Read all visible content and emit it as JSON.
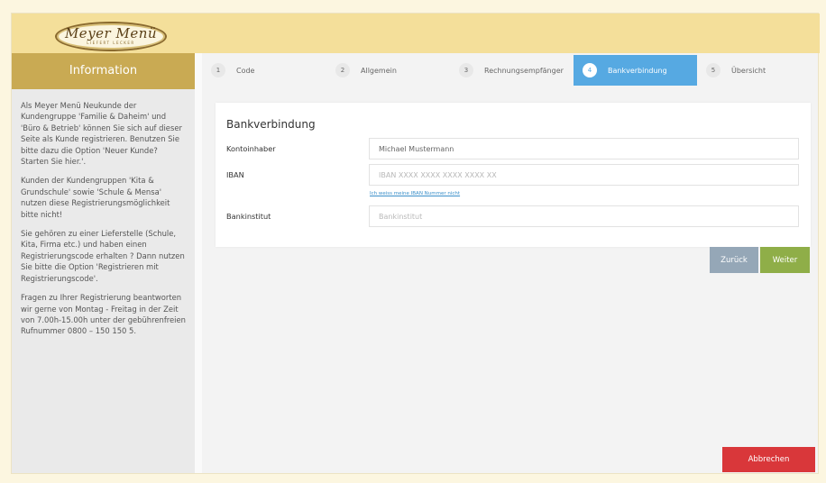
{
  "brand": {
    "name": "Meyer Menü",
    "tagline": "LIEFERT LECKER"
  },
  "sidebar": {
    "title": "Information",
    "paragraphs": [
      "Als Meyer Menü Neukunde der Kundengruppe 'Familie & Daheim' und 'Büro & Betrieb' können Sie sich auf dieser Seite als Kunde registrieren. Benutzen Sie bitte dazu die Option 'Neuer Kunde? Starten Sie hier.'.",
      "Kunden der Kundengruppen 'Kita & Grundschule' sowie 'Schule & Mensa' nutzen diese Registrierungsmöglichkeit bitte nicht!",
      "Sie gehören zu einer Lieferstelle (Schule, Kita, Firma etc.) und haben einen Registrierungscode erhalten ? Dann nutzen Sie bitte die Option 'Registrieren mit Registrierungscode'.",
      "Fragen zu Ihrer Registrierung beantworten wir gerne von Montag - Freitag in der Zeit von 7.00h-15.00h unter der gebührenfreien Rufnummer 0800 – 150 150 5."
    ]
  },
  "steps": [
    {
      "num": "1",
      "label": "Code"
    },
    {
      "num": "2",
      "label": "Allgemein"
    },
    {
      "num": "3",
      "label": "Rechnungsempfänger"
    },
    {
      "num": "4",
      "label": "Bankverbindung"
    },
    {
      "num": "5",
      "label": "Übersicht"
    }
  ],
  "active_step": 4,
  "form": {
    "title": "Bankverbindung",
    "account_holder": {
      "label": "Kontoinhaber",
      "value": "Michael Mustermann",
      "placeholder": ""
    },
    "iban": {
      "label": "IBAN",
      "value": "",
      "placeholder": "IBAN XXXX XXXX XXXX XXXX XX"
    },
    "iban_unknown_link": "Ich weiss meine IBAN Nummer nicht",
    "bank": {
      "label": "Bankinstitut",
      "value": "",
      "placeholder": "Bankinstitut"
    }
  },
  "buttons": {
    "back": "Zurück",
    "next": "Weiter",
    "cancel": "Abbrechen"
  },
  "colors": {
    "header": "#f4df9a",
    "sidebar_title": "#c9aa53",
    "active_step": "#56a9e2",
    "next_button": "#8fae48",
    "back_button": "#95a7b7",
    "cancel_button": "#d9373a"
  }
}
